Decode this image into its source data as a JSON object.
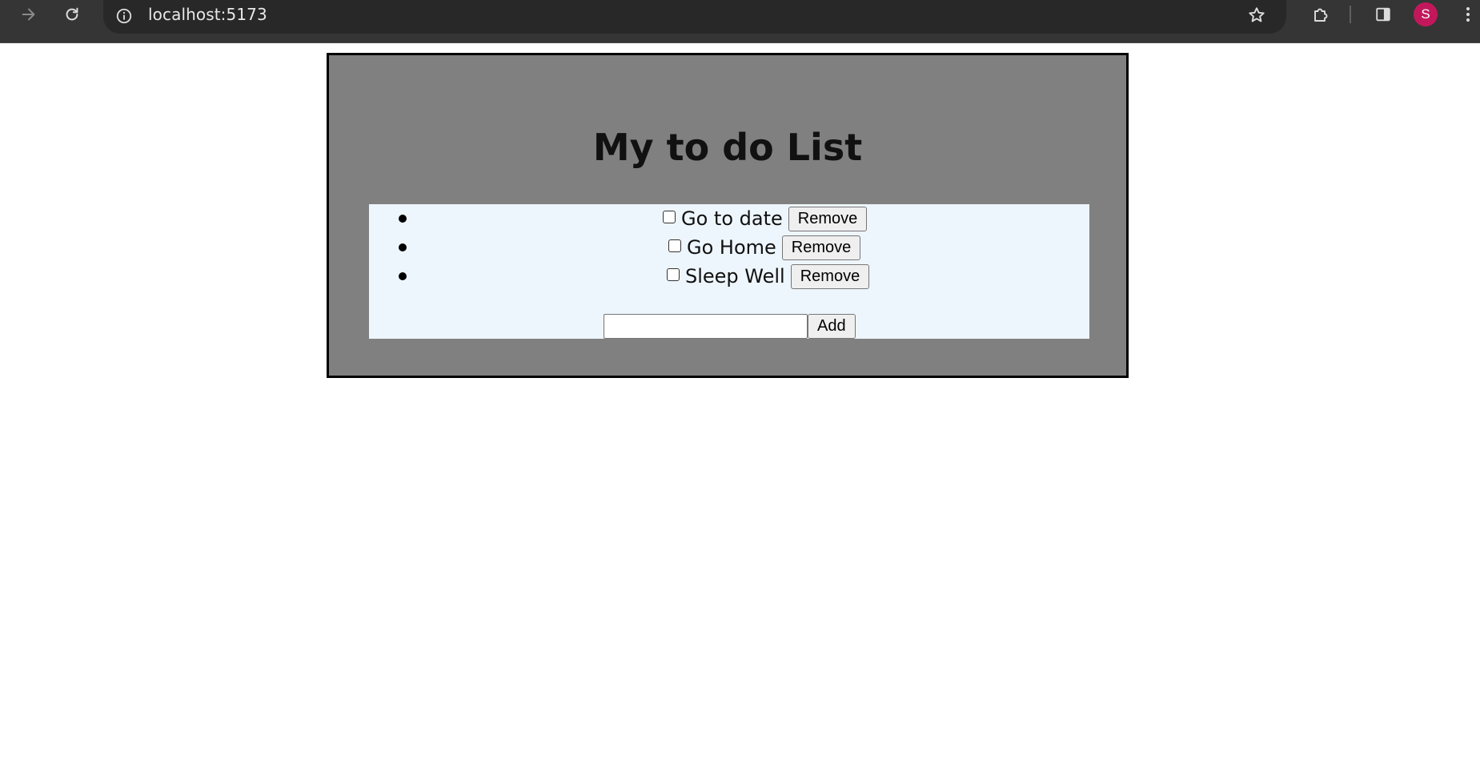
{
  "browser": {
    "url": "localhost:5173",
    "profile_initial": "S",
    "profile_color": "#c2185b",
    "icons": [
      "forward-icon",
      "reload-icon",
      "site-info-icon",
      "bookmark-star-icon",
      "extensions-icon",
      "side-panel-icon",
      "profile-avatar",
      "kebab-menu-icon"
    ]
  },
  "app": {
    "title": "My to do List",
    "todos": [
      {
        "text": "Go to date",
        "checked": false,
        "remove_label": "Remove"
      },
      {
        "text": "Go Home",
        "checked": false,
        "remove_label": "Remove"
      },
      {
        "text": "Sleep Well",
        "checked": false,
        "remove_label": "Remove"
      }
    ],
    "new_todo_value": "",
    "add_label": "Add",
    "colors": {
      "card_background": "#808080",
      "list_background": "#eef6fd",
      "card_border": "#000000"
    }
  }
}
